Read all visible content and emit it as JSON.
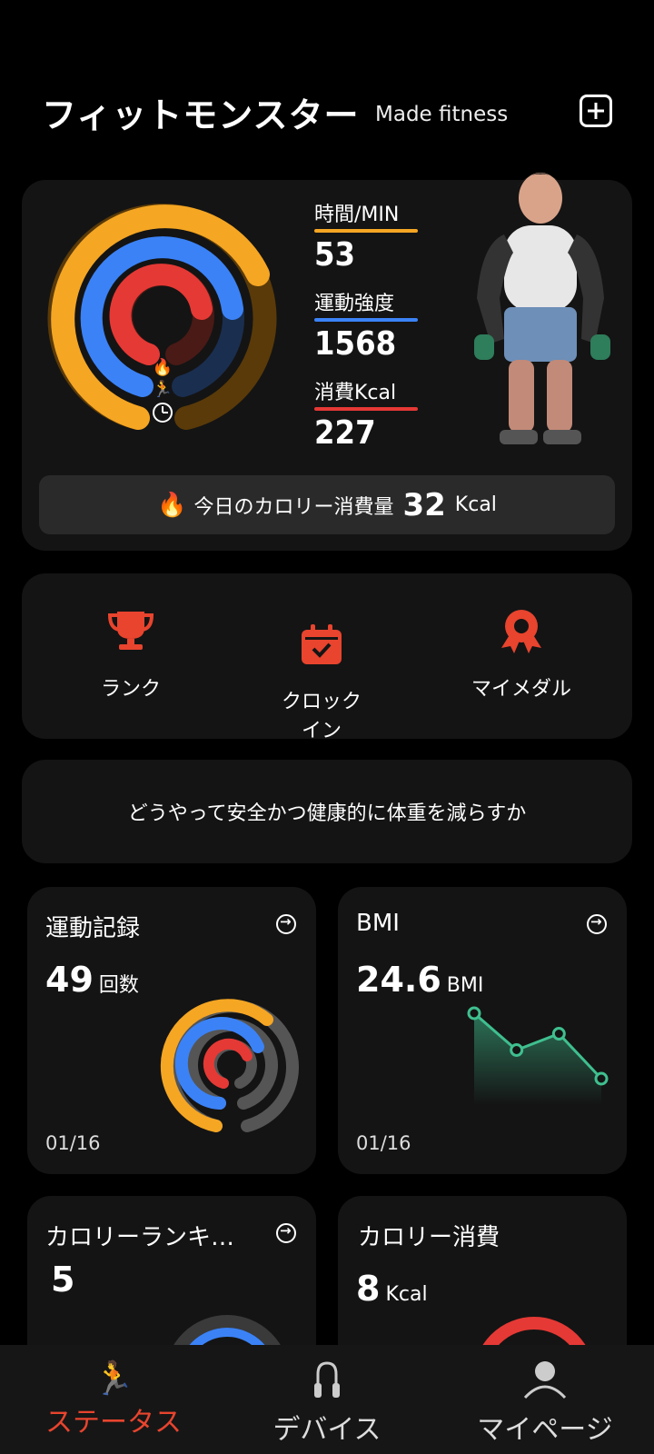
{
  "header": {
    "title": "フィットモンスター",
    "subtitle": "Made fitness"
  },
  "summary": {
    "stats": [
      {
        "label": "時間/MIN",
        "value": "53",
        "color": "#f5a623"
      },
      {
        "label": "運動強度",
        "value": "1568",
        "color": "#3b82f6"
      },
      {
        "label": "消費Kcal",
        "value": "227",
        "color": "#e53935"
      }
    ],
    "rings": {
      "outer_progress": 0.72,
      "middle_progress": 0.6,
      "inner_progress": 0.55
    },
    "banner": {
      "text": "今日のカロリー消費量",
      "value": "32",
      "unit": "Kcal"
    }
  },
  "actions": [
    {
      "label": "ランク",
      "icon": "trophy-icon"
    },
    {
      "label": "クロック\nイン",
      "icon": "calendar-check-icon"
    },
    {
      "label": "マイメダル",
      "icon": "medal-icon"
    }
  ],
  "tip": "どうやって安全かつ健康的に体重を減らすか",
  "cards": {
    "exercise": {
      "title": "運動記録",
      "value": "49",
      "unit": "回数",
      "date": "01/16"
    },
    "bmi": {
      "title": "BMI",
      "value": "24.6",
      "unit": "BMI",
      "date": "01/16",
      "trend": [
        0.9,
        0.45,
        0.65,
        0.1
      ]
    },
    "calorie_rank": {
      "title": "カロリーランキ…",
      "value": "5"
    },
    "calorie": {
      "title": "カロリー消費",
      "value": "8",
      "unit": "Kcal"
    }
  },
  "tabs": [
    {
      "label": "ステータス",
      "icon": "running-icon",
      "active": true
    },
    {
      "label": "デバイス",
      "icon": "jump-rope-icon",
      "active": false
    },
    {
      "label": "マイページ",
      "icon": "person-icon",
      "active": false
    }
  ],
  "colors": {
    "accent": "#e8442e",
    "orange": "#f5a623",
    "blue": "#3b82f6",
    "red": "#e53935",
    "green": "#3fbf8f"
  }
}
